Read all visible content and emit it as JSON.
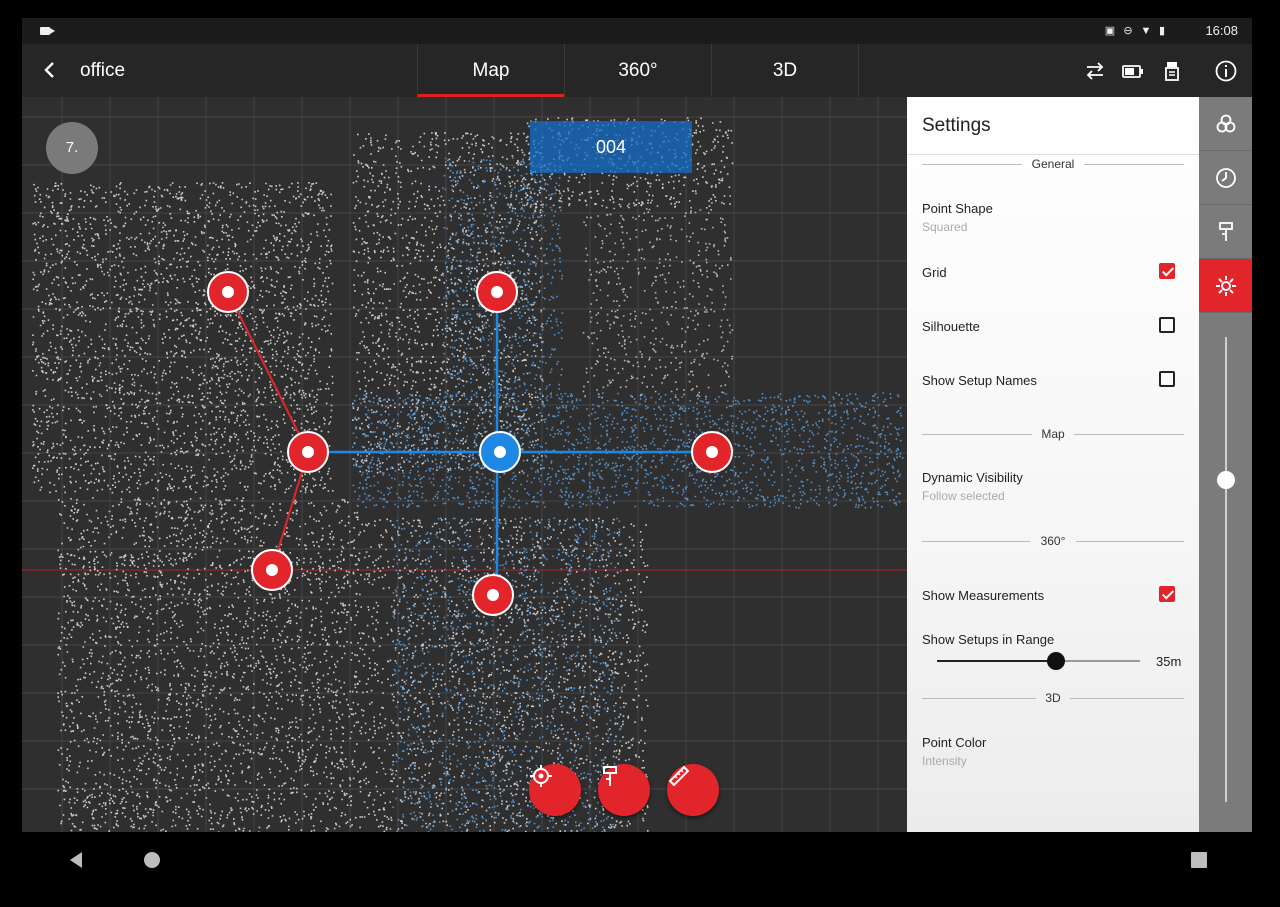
{
  "status_bar": {
    "time": "16:08"
  },
  "app_bar": {
    "title": "office",
    "tabs": [
      {
        "label": "Map",
        "active": true
      },
      {
        "label": "360°",
        "active": false
      },
      {
        "label": "3D",
        "active": false
      }
    ],
    "icons": [
      "swap-icon",
      "battery-icon",
      "scanner-icon",
      "info-icon"
    ]
  },
  "map": {
    "badge": "7.",
    "selected_setup_label": "004",
    "colors": {
      "selected": "#1e88e5",
      "setup": "#e2252b",
      "link_red": "#e2252b",
      "link_blue": "#1e88e5",
      "background": "#2f2f2f"
    },
    "fab_icons": [
      "target-icon",
      "setup-pin-icon",
      "measure-icon"
    ]
  },
  "settings": {
    "title": "Settings",
    "sections": {
      "general": "General",
      "map": "Map",
      "pano": "360°",
      "three_d": "3D"
    },
    "point_shape": {
      "label": "Point Shape",
      "value": "Squared"
    },
    "grid": {
      "label": "Grid",
      "checked": true
    },
    "silhouette": {
      "label": "Silhouette",
      "checked": false
    },
    "show_setup_names": {
      "label": "Show Setup Names",
      "checked": false
    },
    "dynamic_visibility": {
      "label": "Dynamic Visibility",
      "value": "Follow selected"
    },
    "show_measurements": {
      "label": "Show Measurements",
      "checked": true
    },
    "show_setups_in_range": {
      "label": "Show Setups in Range",
      "value": "35m"
    },
    "point_color": {
      "label": "Point Color",
      "value": "Intensity"
    }
  },
  "rail": {
    "icons": [
      "layers-icon",
      "clock-icon",
      "pin-icon",
      "settings-gear-icon"
    ],
    "active": "settings-gear-icon"
  }
}
